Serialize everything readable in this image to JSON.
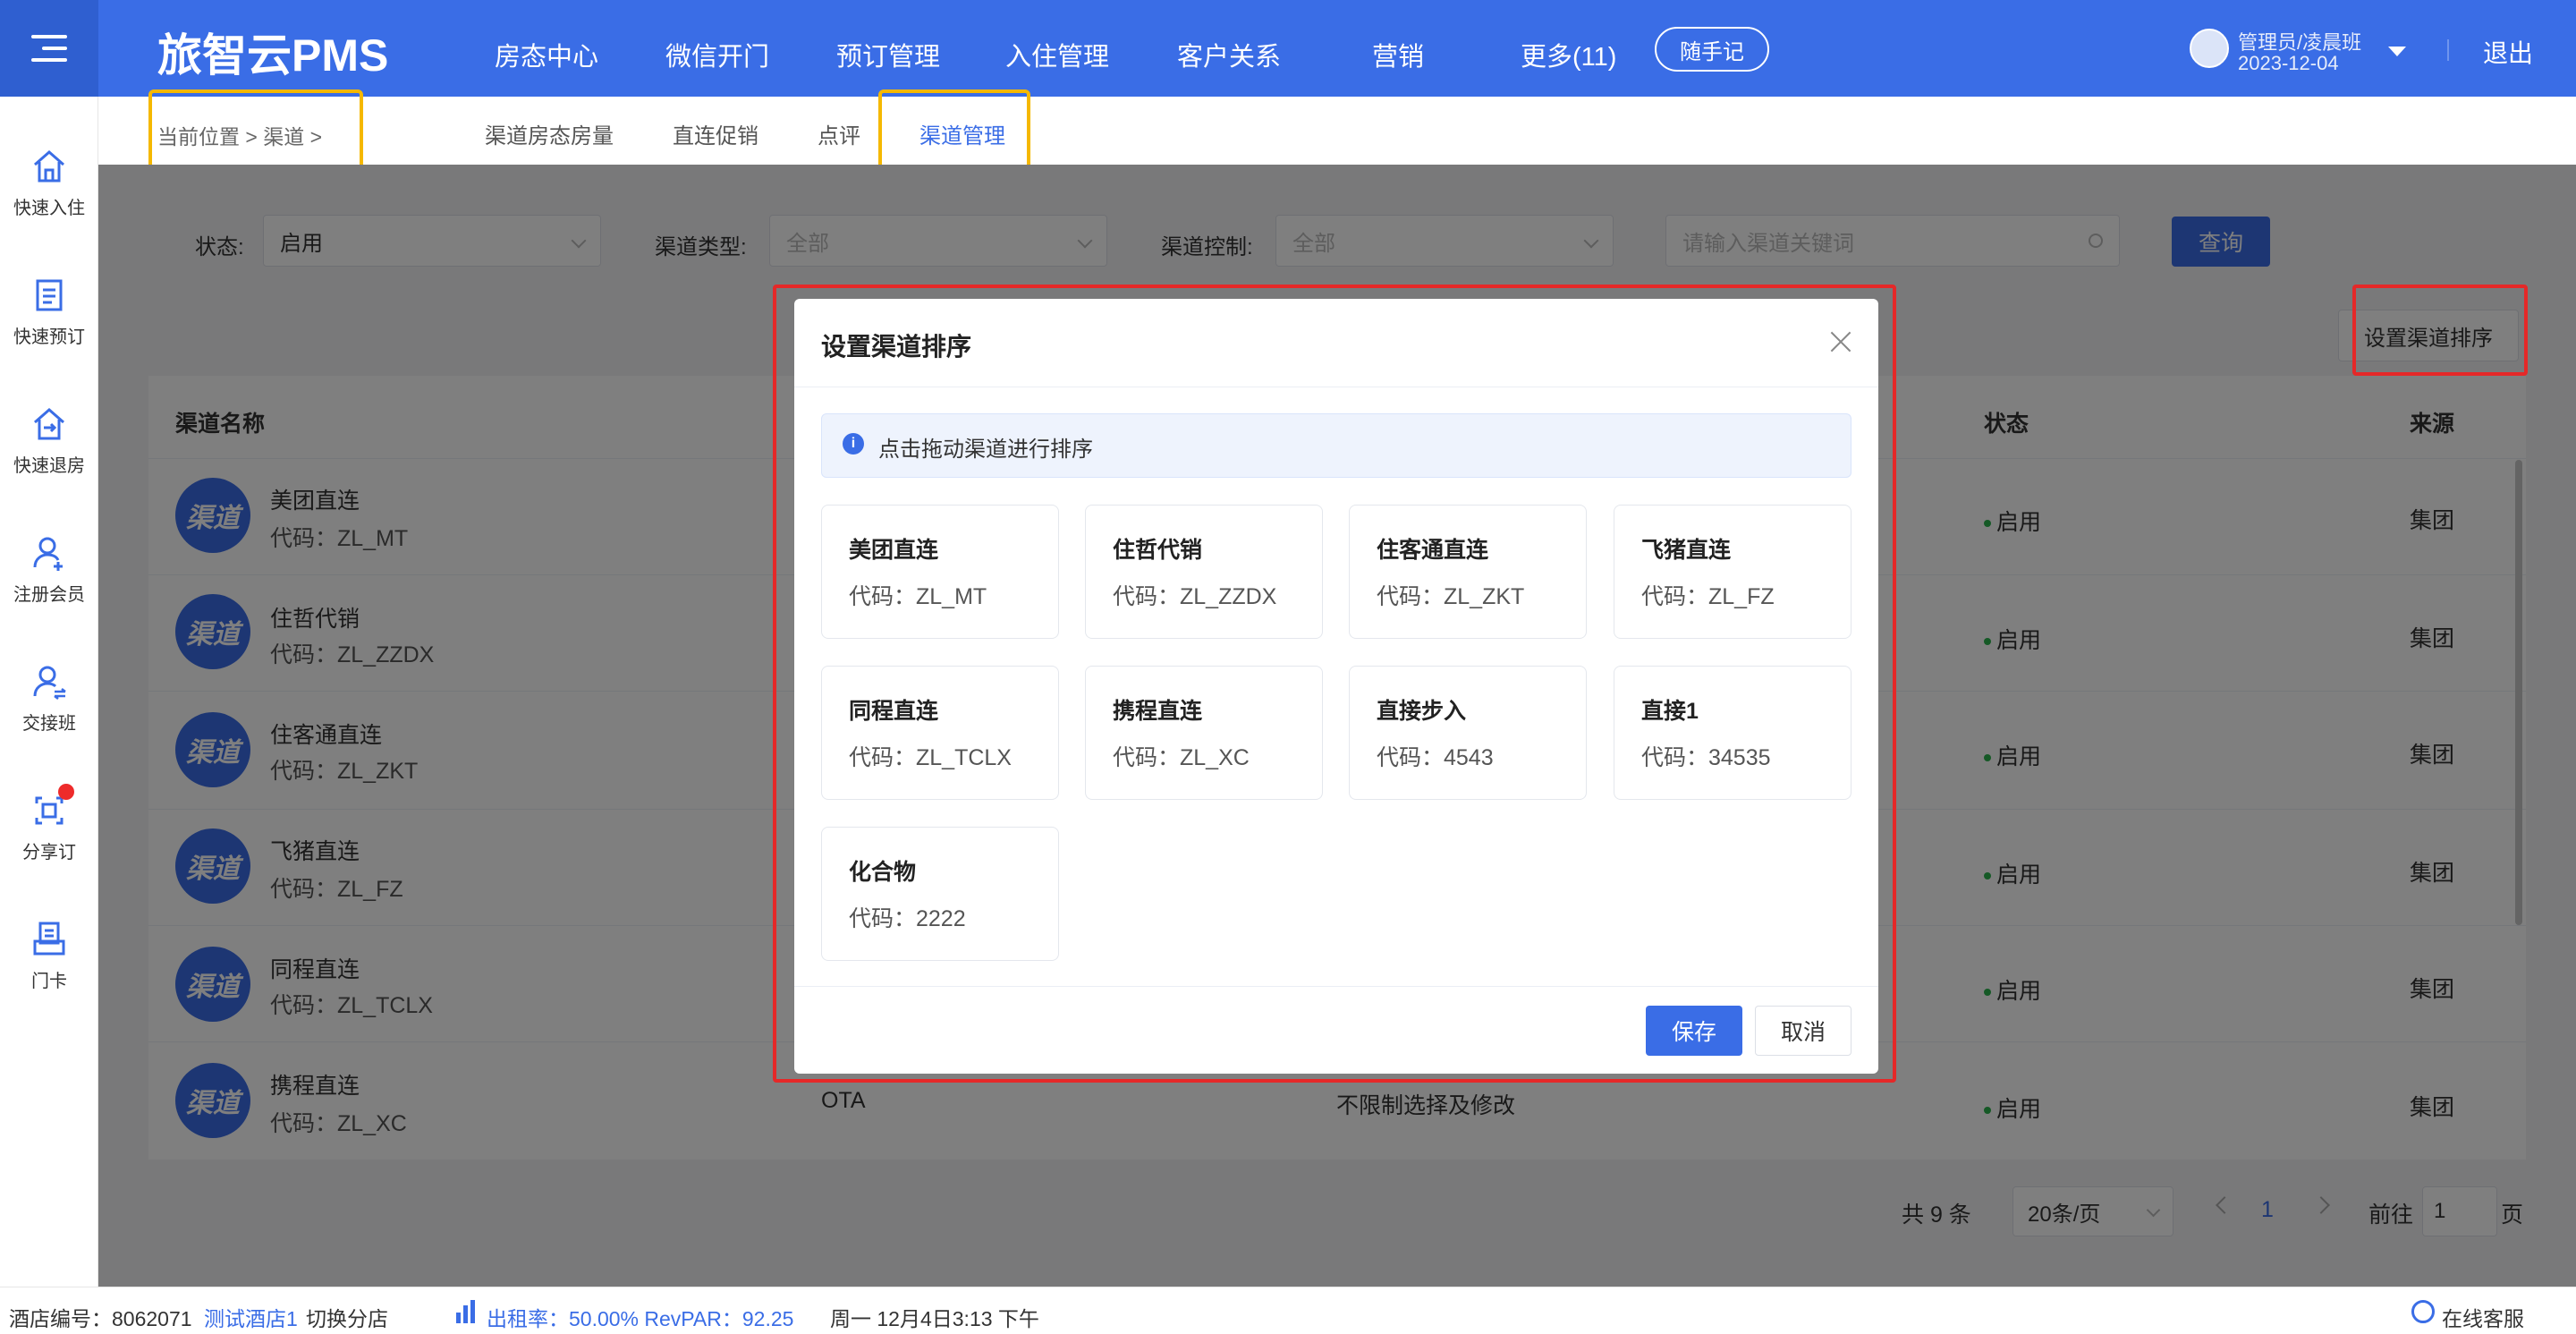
{
  "app": {
    "brand": "旅智云PMS",
    "nav": [
      "房态中心",
      "微信开门",
      "预订管理",
      "入住管理",
      "客户关系",
      "营销",
      "更多(11)"
    ],
    "memo_label": "随手记",
    "user_name": "管理员/凌晨班",
    "user_date": "2023-12-04",
    "logout": "退出"
  },
  "sidebar": {
    "items": [
      {
        "label": "快速入住",
        "icon": "home-icon"
      },
      {
        "label": "快速预订",
        "icon": "document-icon"
      },
      {
        "label": "快速退房",
        "icon": "checkout-icon"
      },
      {
        "label": "注册会员",
        "icon": "add-user-icon"
      },
      {
        "label": "交接班",
        "icon": "handover-icon"
      },
      {
        "label": "分享订",
        "icon": "share-icon"
      },
      {
        "label": "门卡",
        "icon": "card-icon"
      }
    ]
  },
  "breadcrumb": {
    "text": "当前位置  >  渠道   >"
  },
  "subtabs": [
    "渠道房态房量",
    "直连促销",
    "点评",
    "渠道管理"
  ],
  "filters": {
    "status_label": "状态:",
    "status_value": "启用",
    "type_label": "渠道类型:",
    "type_placeholder": "全部",
    "control_label": "渠道控制:",
    "control_placeholder": "全部",
    "search_placeholder": "请输入渠道关键词",
    "query_button": "查询"
  },
  "sort_button": "设置渠道排序",
  "table": {
    "headers": {
      "name": "渠道名称",
      "status": "状态",
      "source": "来源"
    },
    "avatar_text": "渠道",
    "rows": [
      {
        "name": "美团直连",
        "code": "代码：ZL_MT",
        "status": "启用",
        "source": "集团"
      },
      {
        "name": "住哲代销",
        "code": "代码：ZL_ZZDX",
        "status": "启用",
        "source": "集团"
      },
      {
        "name": "住客通直连",
        "code": "代码：ZL_ZKT",
        "status": "启用",
        "source": "集团"
      },
      {
        "name": "飞猪直连",
        "code": "代码：ZL_FZ",
        "status": "启用",
        "source": "集团"
      },
      {
        "name": "同程直连",
        "code": "代码：ZL_TCLX",
        "status": "启用",
        "source": "集团"
      },
      {
        "name": "携程直连",
        "code": "代码：ZL_XC",
        "status": "启用",
        "source": "集团",
        "type": "OTA",
        "control": "不限制选择及修改"
      }
    ]
  },
  "pagination": {
    "total": "共 9 条",
    "page_size": "20条/页",
    "page": "1",
    "goto": "前往",
    "goto_value": "1",
    "unit": "页"
  },
  "modal": {
    "title": "设置渠道排序",
    "tip": "点击拖动渠道进行排序",
    "tip_icon": "i",
    "cards": [
      {
        "name": "美团直连",
        "code": "代码：ZL_MT"
      },
      {
        "name": "住哲代销",
        "code": "代码：ZL_ZZDX"
      },
      {
        "name": "住客通直连",
        "code": "代码：ZL_ZKT"
      },
      {
        "name": "飞猪直连",
        "code": "代码：ZL_FZ"
      },
      {
        "name": "同程直连",
        "code": "代码：ZL_TCLX"
      },
      {
        "name": "携程直连",
        "code": "代码：ZL_XC"
      },
      {
        "name": "直接步入",
        "code": "代码：4543"
      },
      {
        "name": "直接1",
        "code": "代码：34535"
      },
      {
        "name": "化合物",
        "code": "代码：2222"
      }
    ],
    "save": "保存",
    "cancel": "取消"
  },
  "footer": {
    "hotel_no": "酒店编号：8062071",
    "hotel_name": "测试酒店1",
    "switch": "切换分店",
    "occupancy": "出租率：50.00% RevPAR：92.25",
    "datetime": "周一 12月4日3:13 下午",
    "support": "在线客服"
  },
  "colors": {
    "primary": "#3a6de6",
    "highlight_red": "#e52828",
    "highlight_yellow": "#f5b800",
    "status_green": "#2bb24c"
  }
}
